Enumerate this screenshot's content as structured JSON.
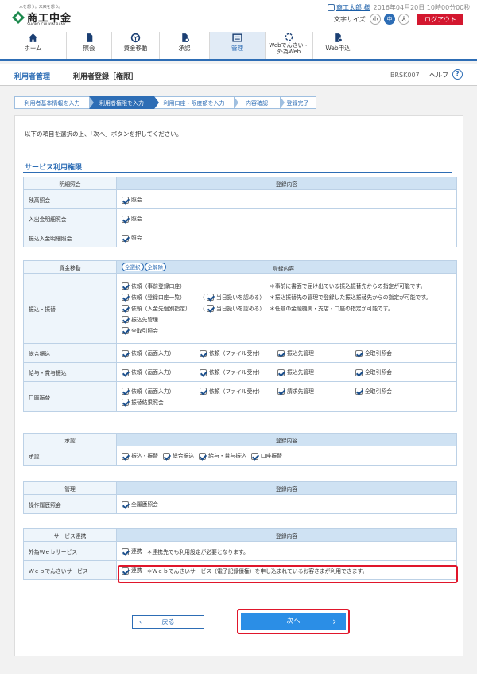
{
  "header": {
    "logo_tagline": "人を想う。未来を想う。",
    "logo_name": "商工中金",
    "logo_en": "SHOKO CHUKIN BANK",
    "user_name": "商工太郎 様",
    "datetime": "2016年04月20日 10時00分00秒",
    "font_size_label": "文字サイズ",
    "font_sizes": [
      "小",
      "中",
      "大"
    ],
    "logout": "ログアウト"
  },
  "nav": [
    {
      "label": "ホーム",
      "icon": "home-icon"
    },
    {
      "label": "照会",
      "icon": "document-icon"
    },
    {
      "label": "資金移動",
      "icon": "money-transfer-icon"
    },
    {
      "label": "承認",
      "icon": "approval-icon"
    },
    {
      "label": "管理",
      "icon": "management-icon"
    },
    {
      "label": "Webでんさい・\n外為Web",
      "icon": "web-densai-icon"
    },
    {
      "label": "Web申込",
      "icon": "web-application-icon"
    }
  ],
  "page": {
    "category": "利用者管理",
    "title": "利用者登録［権限］",
    "code": "BRSK007",
    "help": "ヘルプ"
  },
  "steps": [
    "利用者基本情報を入力",
    "利用者権限を入力",
    "利用口座・限度額を入力",
    "内容確認",
    "登録完了"
  ],
  "intro": "以下の項目を選択の上、「次へ」ボタンを押してください。",
  "section_title": "サービス利用権限",
  "col_content": "登録内容",
  "inquiry": {
    "header": "明細照会",
    "rows": [
      {
        "label": "残高照会",
        "item": "照会"
      },
      {
        "label": "入出金明細照会",
        "item": "照会"
      },
      {
        "label": "振込入金明細照会",
        "item": "照会"
      }
    ]
  },
  "funds": {
    "header": "資金移動",
    "select_all": "全選択",
    "clear_all": "全解除",
    "transfer": {
      "label": "振込・振替",
      "l1": "依頼（事前登録口座）",
      "l1n": "＊事前に書面で届け出ている振込振替先からの指定が可能です。",
      "l2": "依頼（登録口座一覧）",
      "l2o": "当日扱いを認める",
      "l2n": "＊振込振替先の管理で登録した振込振替先からの指定が可能です。",
      "l3": "依頼（入金先個別指定）",
      "l3o": "当日扱いを認める",
      "l3n": "＊任意の金融機関・支店・口座の指定が可能です。",
      "l4": "振込先管理",
      "l5": "全取引照会"
    },
    "general": {
      "label": "総合振込",
      "items": [
        "依頼（画面入力）",
        "依頼（ファイル受付）",
        "振込先管理",
        "全取引照会"
      ]
    },
    "salary": {
      "label": "給与・賞与振込",
      "items": [
        "依頼（画面入力）",
        "依頼（ファイル受付）",
        "振込先管理",
        "全取引照会"
      ]
    },
    "debit": {
      "label": "口座振替",
      "items": [
        "依頼（画面入力）",
        "依頼（ファイル受付）",
        "請求先管理",
        "全取引照会"
      ],
      "extra": "振替結果照会"
    }
  },
  "approval": {
    "header": "承認",
    "label": "承認",
    "items": [
      "振込・振替",
      "総合振込",
      "給与・賞与振込",
      "口座振替"
    ]
  },
  "admin": {
    "header": "管理",
    "label": "操作履歴照会",
    "item": "全履歴照会"
  },
  "service": {
    "header": "サービス連携",
    "r1_label": "外為Ｗｅｂサービス",
    "r1_item": "連携",
    "r1_note": "＊連携先でも利用設定が必要となります。",
    "r2_label": "Ｗｅｂでんさいサービス",
    "r2_item": "連携",
    "r2_note": "＊Ｗｅｂでんさいサービス（電子記録債権）を申し込まれているお客さまが利用できます。"
  },
  "buttons": {
    "back": "戻る",
    "next": "次へ"
  }
}
